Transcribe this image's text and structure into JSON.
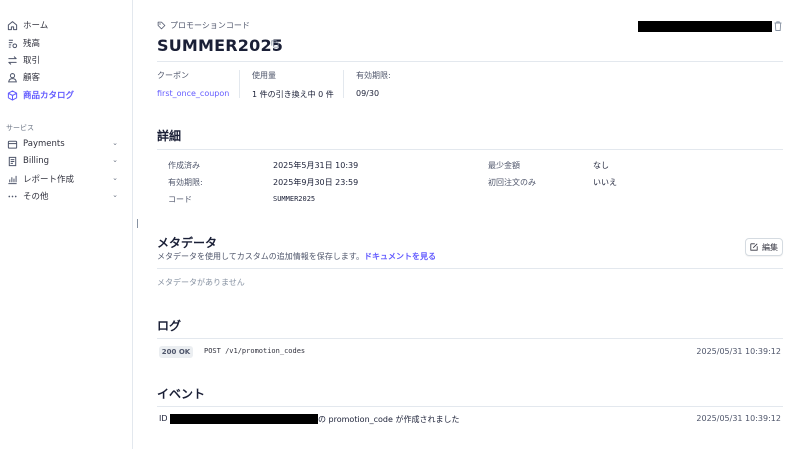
{
  "sidebar": {
    "items": [
      {
        "label": "ホーム",
        "icon": "home-icon"
      },
      {
        "label": "残高",
        "icon": "balance-icon"
      },
      {
        "label": "取引",
        "icon": "transactions-icon"
      },
      {
        "label": "顧客",
        "icon": "customers-icon"
      },
      {
        "label": "商品カタログ",
        "icon": "product-catalog-icon",
        "active": true
      }
    ],
    "section_label": "サービス",
    "services": [
      {
        "label": "Payments",
        "icon": "payments-icon"
      },
      {
        "label": "Billing",
        "icon": "billing-icon"
      },
      {
        "label": "レポート作成",
        "icon": "reports-icon"
      },
      {
        "label": "その他",
        "icon": "more-icon"
      }
    ]
  },
  "header": {
    "eyebrow": "プロモーションコード",
    "title": "SUMMER2025"
  },
  "summary": {
    "coupon_label": "クーポン",
    "coupon_value": "first_once_coupon",
    "usage_label": "使用量",
    "usage_value": "1 件の引き換え中 0 件",
    "expiry_label": "有効期限:",
    "expiry_value": "09/30"
  },
  "details": {
    "heading": "詳細",
    "created_label": "作成済み",
    "created_value": "2025年5月31日 10:39",
    "expires_label": "有効期限:",
    "expires_value": "2025年9月30日 23:59",
    "code_label": "コード",
    "code_value": "SUMMER2025",
    "min_amount_label": "最少金額",
    "min_amount_value": "なし",
    "first_order_label": "初回注文のみ",
    "first_order_value": "いいえ"
  },
  "metadata": {
    "heading": "メタデータ",
    "description": "メタデータを使用してカスタムの追加情報を保存します。",
    "doc_link": "ドキュメントを見る",
    "edit_label": "編集",
    "empty": "メタデータがありません"
  },
  "logs": {
    "heading": "ログ",
    "entries": [
      {
        "status": "200 OK",
        "request": "POST /v1/promotion_codes",
        "time": "2025/05/31 10:39:12"
      }
    ]
  },
  "events": {
    "heading": "イベント",
    "entries": [
      {
        "id_label": "ID",
        "message": "の promotion_code が作成されました",
        "time": "2025/05/31 10:39:12"
      }
    ]
  },
  "colors": {
    "accent": "#635bff",
    "text": "#1a1f36",
    "muted": "#4f566b",
    "border": "#e3e8ee"
  }
}
